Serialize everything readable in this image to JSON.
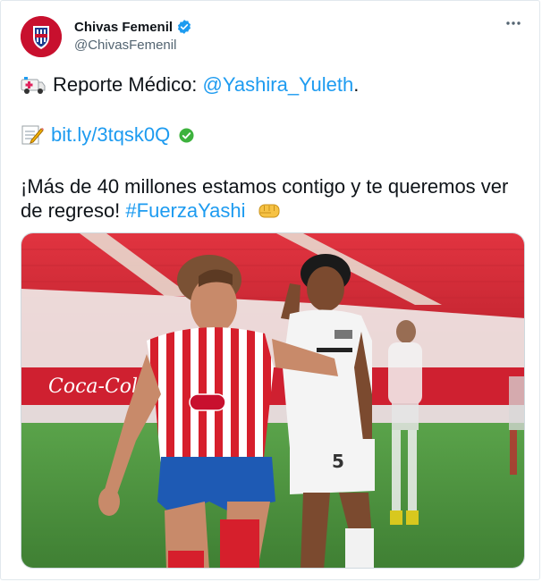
{
  "account": {
    "display_name": "Chivas Femenil",
    "handle": "@ChivasFemenil",
    "avatar_icon": "chivas-crest-icon",
    "verified_icon": "verified-badge-icon"
  },
  "tweet": {
    "line1_text": "Reporte Médico: ",
    "line1_mention": "@Yashira_Yuleth",
    "line1_suffix": ".",
    "line2_link": "bit.ly/3tqsk0Q",
    "line3_text": "¡Más de 40 millones estamos contigo y te queremos ver",
    "line4_text": "de regreso! ",
    "line4_hashtag": "#FuerzaYashi"
  },
  "media": {
    "banner_text": "Coca-Cola",
    "shirt_number": "5"
  },
  "colors": {
    "link": "#1d9bf0",
    "chivas_red": "#c8102e",
    "pitch_green": "#4a8a3a",
    "stadium_red": "#d72a35"
  }
}
